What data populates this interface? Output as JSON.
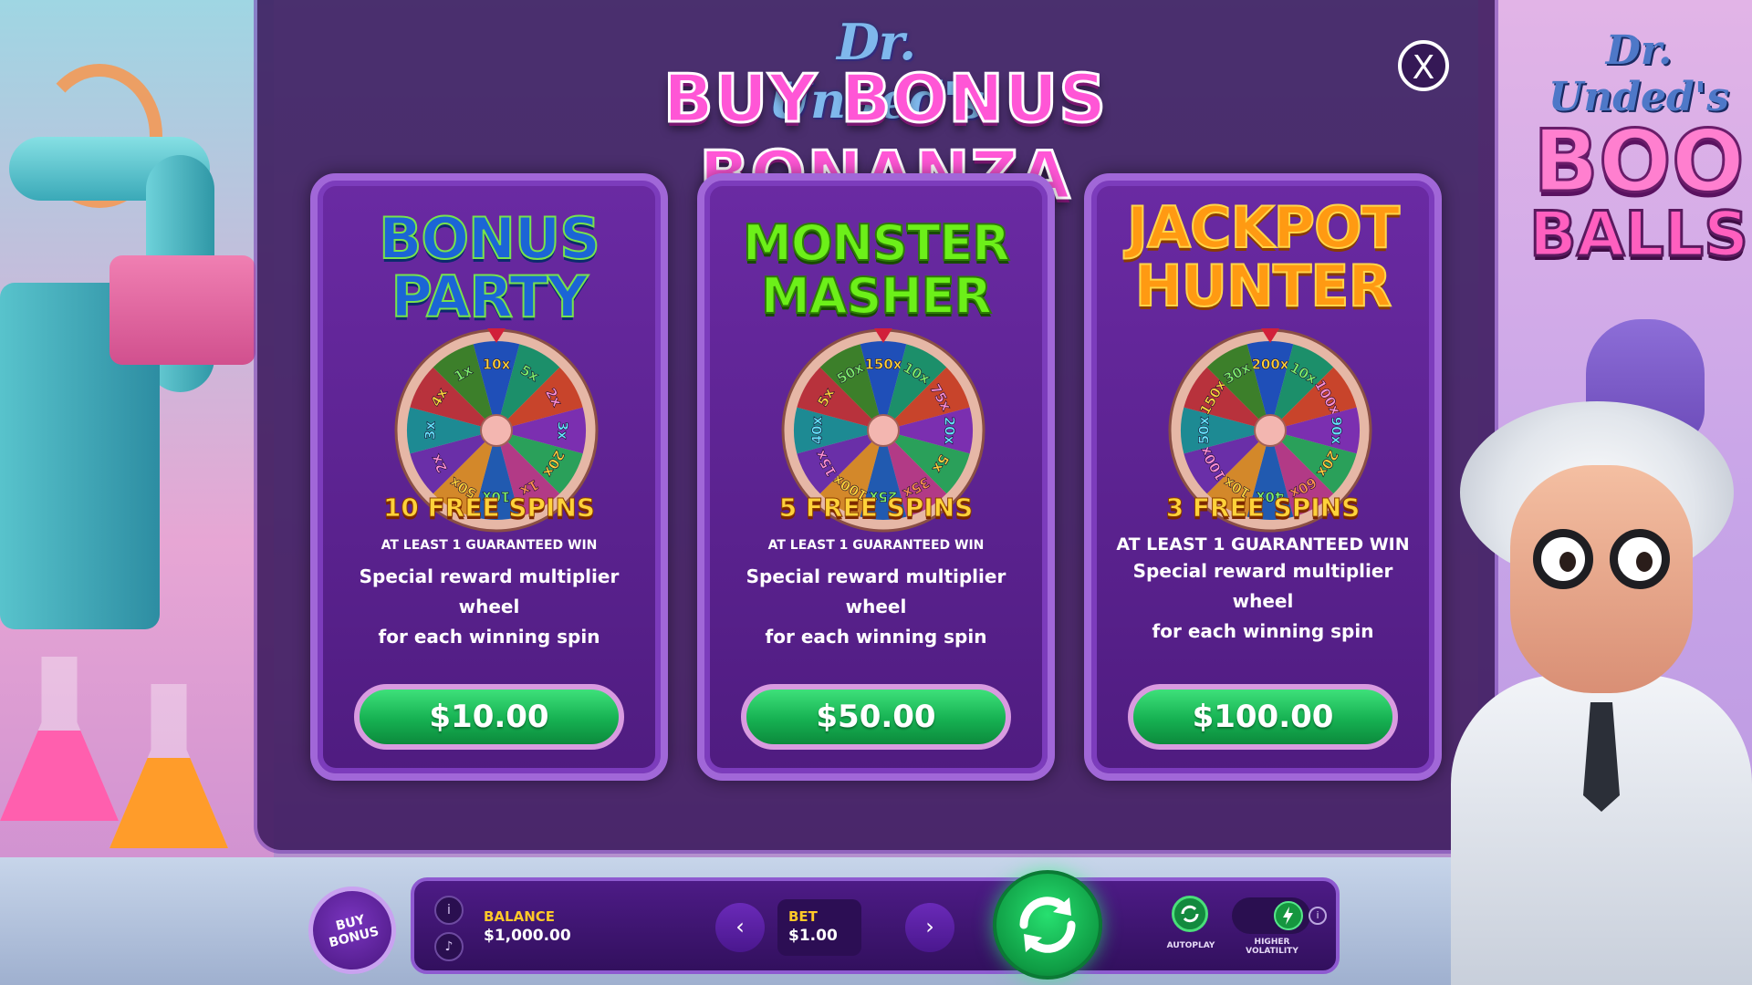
{
  "header": {
    "brand": "Dr. Unded's",
    "title": "BUY BONUS BONANZA",
    "close_label": "X"
  },
  "logo": {
    "small": "Dr. Unded's",
    "line1": "BOO",
    "line2": "BALLS"
  },
  "cards": [
    {
      "title_lines": [
        "BONUS",
        "PARTY"
      ],
      "title_color": "#1b65d6",
      "wheel_labels": [
        "10x",
        "5x",
        "2x",
        "3x",
        "20x",
        "1x",
        "10x",
        "50x",
        "2x",
        "3x",
        "4x",
        "1x"
      ],
      "spins": "10 FREE SPINS",
      "guarantee": "AT LEAST 1 GUARANTEED WIN",
      "desc_line1": "Special reward multiplier wheel",
      "desc_line2": "for each winning spin",
      "price": "$10.00"
    },
    {
      "title_lines": [
        "MONSTER",
        "MASHER"
      ],
      "title_color": "#6cf019",
      "wheel_labels": [
        "150x",
        "10x",
        "75x",
        "20x",
        "5x",
        "35x",
        "25x",
        "100x",
        "15x",
        "40x",
        "5x",
        "50x"
      ],
      "spins": "5 FREE SPINS",
      "guarantee": "AT LEAST 1 GUARANTEED WIN",
      "desc_line1": "Special reward multiplier wheel",
      "desc_line2": "for each winning spin",
      "price": "$50.00"
    },
    {
      "title_lines": [
        "JACKPOT",
        "HUNTER"
      ],
      "title_color": "#ff9a12",
      "wheel_labels": [
        "200x",
        "10x",
        "100x",
        "90x",
        "20x",
        "60x",
        "40x",
        "10x",
        "100x",
        "50x",
        "150x",
        "30x"
      ],
      "spins": "3 FREE SPINS",
      "guarantee": "AT LEAST 1 GUARANTEED WIN",
      "desc_line1": "Special reward multiplier wheel",
      "desc_line2": "for each winning spin",
      "price": "$100.00"
    }
  ],
  "controls": {
    "buy_bonus_line1": "BUY",
    "buy_bonus_line2": "BONUS",
    "balance_label": "BALANCE",
    "balance_value": "$1,000.00",
    "bet_label": "BET",
    "bet_value": "$1.00",
    "autoplay_label": "AUTOPLAY",
    "volatility_line1": "HIGHER",
    "volatility_line2": "VOLATILITY",
    "info_icon": "info-icon",
    "sound_icon": "speaker-icon",
    "spin_icon": "refresh-arrows-icon"
  },
  "colors": {
    "accent_pink": "#ff56d6",
    "price_green": "#16b152",
    "card_purple": "#5a2290",
    "label_gold": "#ffc928"
  }
}
